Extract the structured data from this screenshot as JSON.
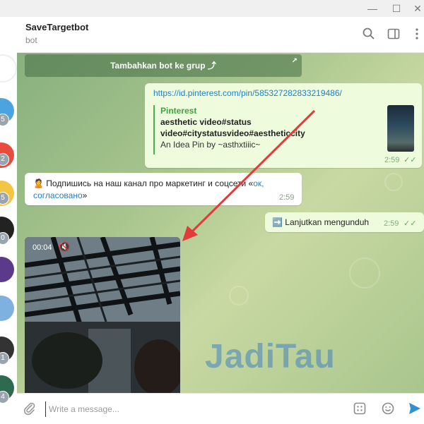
{
  "window": {
    "minimize": "—",
    "maximize": "☐",
    "close": "✕"
  },
  "header": {
    "title": "SaveTargetbot",
    "subtitle": "bot",
    "icons": [
      "search-icon",
      "sidebar-toggle-icon",
      "more-icon"
    ]
  },
  "dialogs": {
    "badges": [
      "5",
      "2",
      "5",
      "0",
      "1",
      "4"
    ]
  },
  "chat": {
    "bot_button": {
      "label": "Tambahkan bot ke grup ⤴"
    },
    "message1": {
      "link": "https://id.pinterest.com/pin/585327282833219486/",
      "preview_site": "Pinterest",
      "preview_title": "aesthetic video#status video#citystatusvideo#aestheticcity",
      "preview_desc": "An Idea Pin by ~asthxtiiic~",
      "time": "2:59",
      "ticks": "✓✓"
    },
    "message2": {
      "emoji": "🙎",
      "text": "Подпишись на наш канал про маркетинг и соцсети «",
      "link": "ок, согласовано",
      "text_end": "»",
      "time": "2:59"
    },
    "message3": {
      "emoji": "➡️",
      "text": "Lanjutkan mengunduh",
      "time": "2:59",
      "ticks": "✓✓"
    },
    "video": {
      "duration": "00:04",
      "sound": "🔇"
    },
    "watermark": "JadiTau"
  },
  "compose": {
    "placeholder": "Write a message...",
    "icons": [
      "attach-icon",
      "commands-icon",
      "emoji-icon",
      "send-icon"
    ]
  },
  "colors": {
    "accent": "#1f7fc8",
    "outgoing_bubble": "#eefcdd",
    "arrow": "#e33b3b"
  }
}
